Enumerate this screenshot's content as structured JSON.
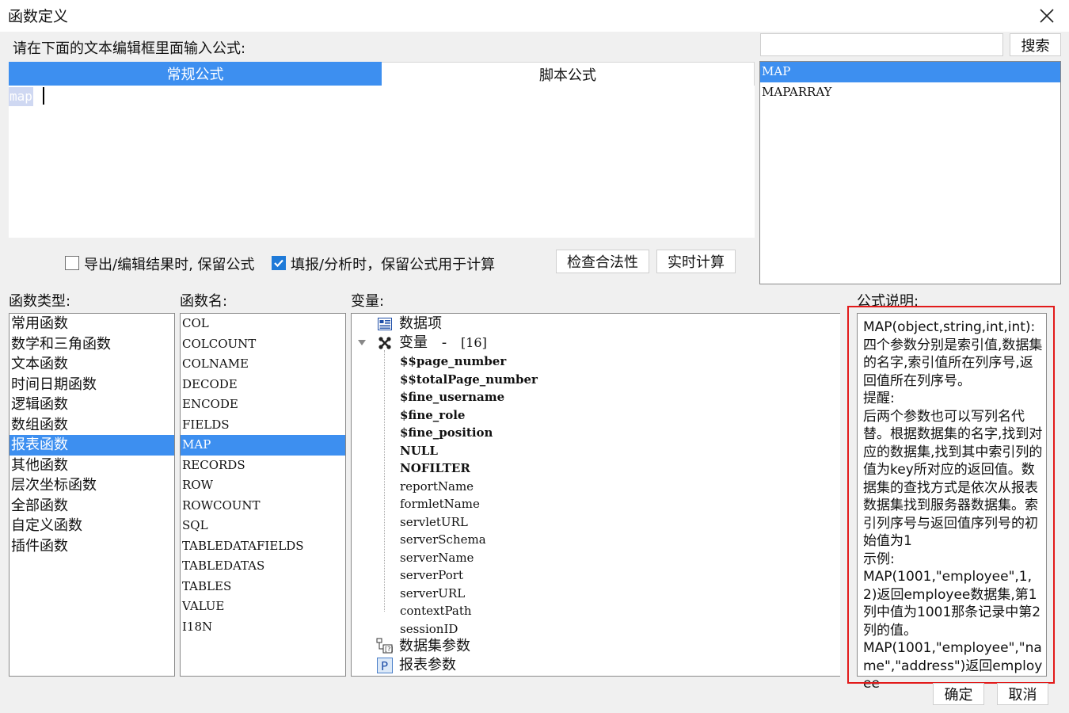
{
  "window": {
    "title": "函数定义"
  },
  "formula": {
    "prompt": "请在下面的文本编辑框里面输入公式:",
    "tabs": [
      {
        "label": "常规公式"
      },
      {
        "label": "脚本公式"
      }
    ],
    "editor_value": "map"
  },
  "search": {
    "value": "",
    "button": "搜索"
  },
  "results": [
    "MAP",
    "MAPARRAY"
  ],
  "options": {
    "keep_formula_export": {
      "label": "导出/编辑结果时, 保留公式",
      "checked": false
    },
    "keep_formula_fill": {
      "label": "填报/分析时，保留公式用于计算",
      "checked": true
    }
  },
  "buttons": {
    "check": "检查合法性",
    "realtime": "实时计算",
    "ok": "确定",
    "cancel": "取消"
  },
  "panels": {
    "type_label": "函数类型:",
    "name_label": "函数名:",
    "var_label": "变量:",
    "desc_label": "公式说明:"
  },
  "function_types": [
    "常用函数",
    "数学和三角函数",
    "文本函数",
    "时间日期函数",
    "逻辑函数",
    "数组函数",
    "报表函数",
    "其他函数",
    "层次坐标函数",
    "全部函数",
    "自定义函数",
    "插件函数"
  ],
  "function_names": [
    "COL",
    "COLCOUNT",
    "COLNAME",
    "DECODE",
    "ENCODE",
    "FIELDS",
    "MAP",
    "RECORDS",
    "ROW",
    "ROWCOUNT",
    "SQL",
    "TABLEDATAFIELDS",
    "TABLEDATAS",
    "TABLES",
    "VALUE",
    "I18N"
  ],
  "variables": {
    "data_item": "数据项",
    "var_node": "变量",
    "var_dash": "-",
    "var_count": "[16]",
    "children": [
      "$$page_number",
      "$$totalPage_number",
      "$fine_username",
      "$fine_role",
      "$fine_position",
      "NULL",
      "NOFILTER",
      "reportName",
      "formletName",
      "servletURL",
      "serverSchema",
      "serverName",
      "serverPort",
      "serverURL",
      "contextPath",
      "sessionID"
    ],
    "dataset_params": "数据集参数",
    "report_params": "报表参数"
  },
  "description": "MAP(object,string,int,int):四个参数分别是索引值,数据集的名字,索引值所在列序号,返回值所在列序号。\n提醒:\n后两个参数也可以写列名代替。根据数据集的名字,找到对应的数据集,找到其中索引列的值为key所对应的返回值。数据集的查找方式是依次从报表数据集找到服务器数据集。索引列序号与返回值序列号的初始值为1\n示例:\nMAP(1001,\"employee\",1,2)返回employee数据集,第1列中值为1001那条记录中第2列的值。\nMAP(1001,\"employee\",\"name\",\"address\")返回employee",
  "colors": {
    "accent": "#3d8ff0",
    "highlight": "#e21a1a"
  }
}
